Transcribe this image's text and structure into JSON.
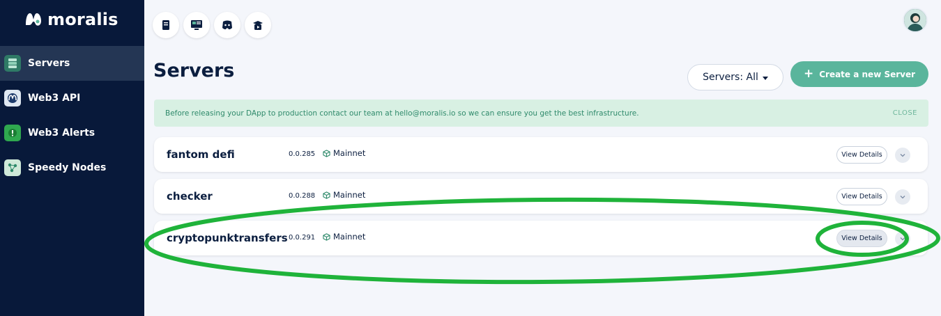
{
  "sidebar": {
    "brand": "moralis",
    "items": [
      {
        "label": "Servers",
        "icon": "servers-icon",
        "active": true
      },
      {
        "label": "Web3 API",
        "icon": "web3-api-icon",
        "active": false
      },
      {
        "label": "Web3 Alerts",
        "icon": "web3-alerts-icon",
        "active": false
      },
      {
        "label": "Speedy Nodes",
        "icon": "speedy-nodes-icon",
        "active": false
      }
    ]
  },
  "topbar": {
    "icons": [
      "docs-book-icon",
      "tutorials-monitor-icon",
      "discord-icon",
      "youtube-academy-icon"
    ]
  },
  "header": {
    "title": "Servers",
    "filter_label": "Servers: All",
    "create_label": "Create a new Server"
  },
  "alert": {
    "text": "Before releasing your DApp to production contact our team at hello@moralis.io so we can ensure you get the best infrastructure.",
    "close_label": "CLOSE"
  },
  "servers": [
    {
      "name": "fantom defi",
      "version": "0.0.285",
      "network": "Mainnet",
      "action": "View Details"
    },
    {
      "name": "checker",
      "version": "0.0.288",
      "network": "Mainnet",
      "action": "View Details"
    },
    {
      "name": "cryptopunktransfers",
      "version": "0.0.291",
      "network": "Mainnet",
      "action": "View Details"
    }
  ],
  "colors": {
    "sidebar_bg": "#08193a",
    "accent_green": "#5ab59c",
    "annotation_green": "#1fb33a",
    "alert_bg": "#d8f0e3"
  }
}
